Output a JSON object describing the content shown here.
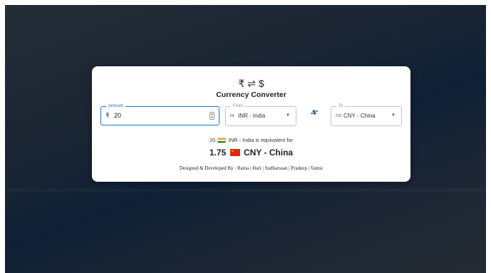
{
  "header": {
    "logo_rupee": "₹",
    "logo_arrows": "⇌",
    "logo_dollar": "$",
    "title": "Currency Converter"
  },
  "amount": {
    "label": "Amount",
    "symbol": "₹",
    "value": "20"
  },
  "from": {
    "label": "From",
    "code": "IN",
    "value": "INR - India"
  },
  "to": {
    "label": "To",
    "code": "CN",
    "value": "CNY - China"
  },
  "swap_icon": "swap-arrows-icon",
  "result": {
    "input_amount": "20",
    "from_currency": "INR - India",
    "equiv_text": "is equivalent for",
    "converted_value": "1.75",
    "to_currency": "CNY - China"
  },
  "footer": {
    "credits": "Designed & Developed By : Ratna | Hari | Sudharssan | Pradeep | Vamsi"
  },
  "colors": {
    "accent": "#1976d2",
    "swap_icon": "#1e4f9c",
    "background_dark": "#0f2035",
    "card": "#ffffff"
  }
}
